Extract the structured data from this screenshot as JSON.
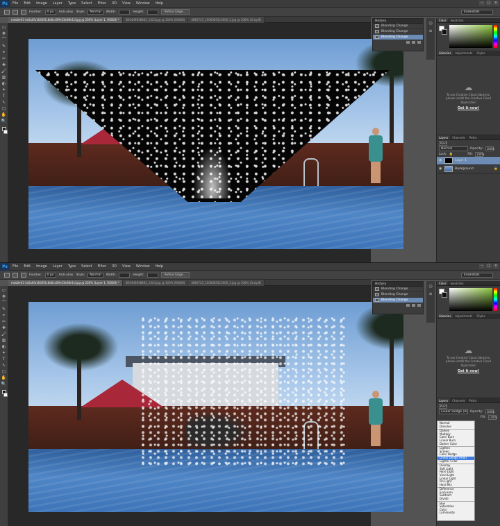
{
  "app": {
    "logo": "Ps"
  },
  "menu": [
    "File",
    "Edit",
    "Image",
    "Layer",
    "Type",
    "Select",
    "Filter",
    "3D",
    "View",
    "Window",
    "Help"
  ],
  "window_controls": [
    "–",
    "□",
    "×"
  ],
  "options": {
    "feather_label": "Feather:",
    "feather_value": "0 px",
    "antialias_label": "Anti-alias",
    "style_label": "Style:",
    "style_value": "Normal",
    "width_label": "Width:",
    "height_label": "Height:",
    "refine_label": "Refine Edge...",
    "workspace": "Essentials"
  },
  "tabs_top": [
    {
      "label": "mobile01-4c6a0fa1643f5c8d6ce09e33e68e1d.jpg @ 200% (Layer 1, RGB/8) *",
      "active": true
    },
    {
      "label": "5D0449838862_1024.jpg @ 100% (RGB/8)",
      "active": false
    },
    {
      "label": "4660723_1006083510000_2.jpg @ 100% (Gray/8)",
      "active": false
    }
  ],
  "tabs_bottom": [
    {
      "label": "mobile01-4c6a0fa1643f5c8d6ce09e33e68e1d.jpg @ 200% (Layer 1, RGB/8) *",
      "active": true
    },
    {
      "label": "5D0449838862_1024.jpg @ 100% (RGB/8)",
      "active": false
    },
    {
      "label": "4660723_1006083510000_2.jpg @ 100% (Gray/8)",
      "active": false
    }
  ],
  "history": {
    "title": "History",
    "items": [
      "Blending Change",
      "Blending Change",
      "Blending Change"
    ]
  },
  "color_panel": {
    "tabs": [
      "Color",
      "Swatches"
    ]
  },
  "libraries": {
    "tabs": [
      "Libraries",
      "Adjustments",
      "Styles"
    ],
    "message": "To use Creative Cloud Libraries, please install the Creative Cloud Application",
    "link": "Get it now!"
  },
  "layers_top": {
    "tabs": [
      "Layers",
      "Channels",
      "Paths"
    ],
    "kind": "Kind",
    "blend_mode": "Normal",
    "opacity_label": "Opacity:",
    "opacity_value": "100%",
    "lock_label": "Lock:",
    "fill_label": "Fill:",
    "fill_value": "100%",
    "layers": [
      {
        "name": "Layer 1",
        "selected": true
      },
      {
        "name": "Background",
        "selected": false
      }
    ]
  },
  "layers_bottom": {
    "tabs": [
      "Layers",
      "Channels",
      "Paths"
    ],
    "kind": "Kind",
    "blend_mode": "Linear Dodge (Add)",
    "opacity_label": "Opacity:",
    "opacity_value": "100%",
    "fill_label": "Fill:",
    "fill_value": "100%"
  },
  "blend_modes": [
    [
      "Normal",
      "Dissolve"
    ],
    [
      "Darken",
      "Multiply",
      "Color Burn",
      "Linear Burn",
      "Darker Color"
    ],
    [
      "Lighten",
      "Screen",
      "Color Dodge",
      "Linear Dodge (Add)",
      "Lighter Color"
    ],
    [
      "Overlay",
      "Soft Light",
      "Hard Light",
      "Vivid Light",
      "Linear Light",
      "Pin Light",
      "Hard Mix"
    ],
    [
      "Difference",
      "Exclusion",
      "Subtract",
      "Divide"
    ],
    [
      "Hue",
      "Saturation",
      "Color",
      "Luminosity"
    ]
  ],
  "blend_selected": "Linear Dodge (Add)",
  "tools": [
    "▭",
    "✥",
    "⌒",
    "✎",
    "⌖",
    "✂",
    "✚",
    "🖌",
    "▥",
    "◐",
    "✦",
    "T",
    "↖",
    "▢",
    "✋",
    "🔍"
  ],
  "side_icons": [
    "◷",
    "≡"
  ]
}
